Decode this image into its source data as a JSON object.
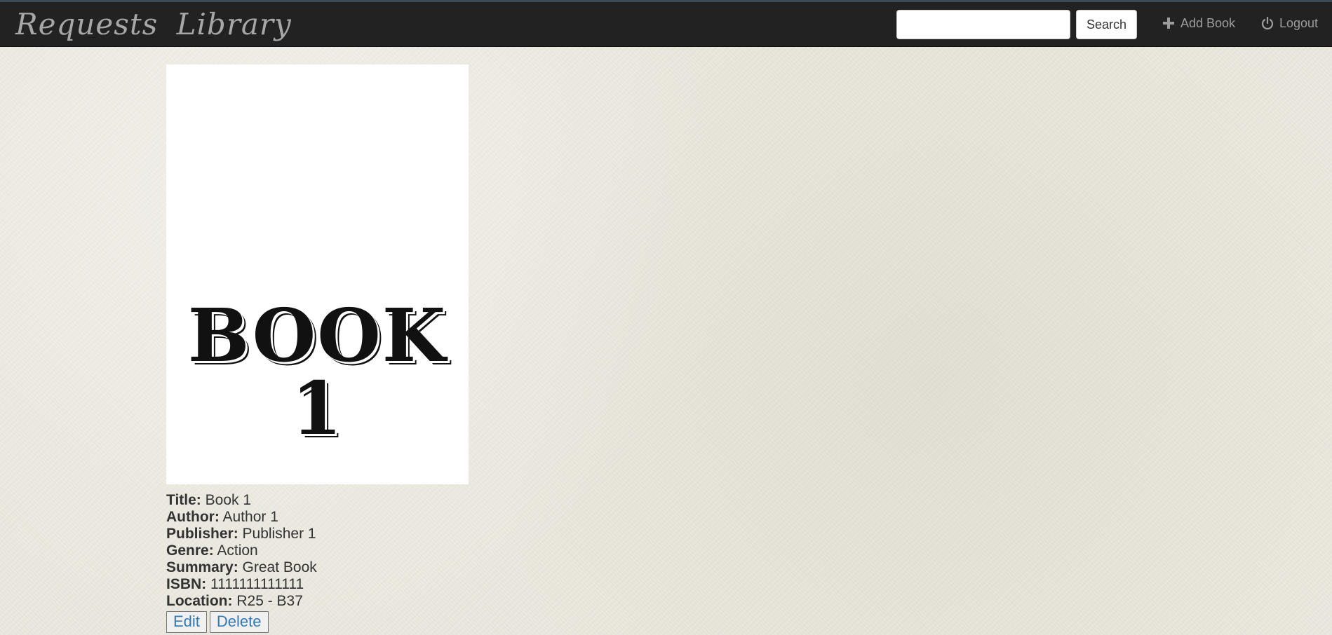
{
  "navbar": {
    "brand": "Requests  Library",
    "search": {
      "placeholder": "",
      "value": "",
      "button_label": "Search"
    },
    "add_book_label": "Add Book",
    "logout_label": "Logout",
    "background_color": "#222222"
  },
  "book": {
    "cover_text": "BOOK 1",
    "fields": {
      "title_label": "Title:",
      "title_value": "Book 1",
      "author_label": "Author:",
      "author_value": "Author 1",
      "publisher_label": "Publisher:",
      "publisher_value": "Publisher 1",
      "genre_label": "Genre:",
      "genre_value": "Action",
      "summary_label": "Summary:",
      "summary_value": "Great Book",
      "isbn_label": "ISBN:",
      "isbn_value": "1111111111111",
      "location_label": "Location:",
      "location_value": "R25 - B37"
    },
    "actions": {
      "edit_label": "Edit",
      "delete_label": "Delete"
    }
  },
  "icons": {
    "add": "plus-icon",
    "logout": "power-icon"
  }
}
